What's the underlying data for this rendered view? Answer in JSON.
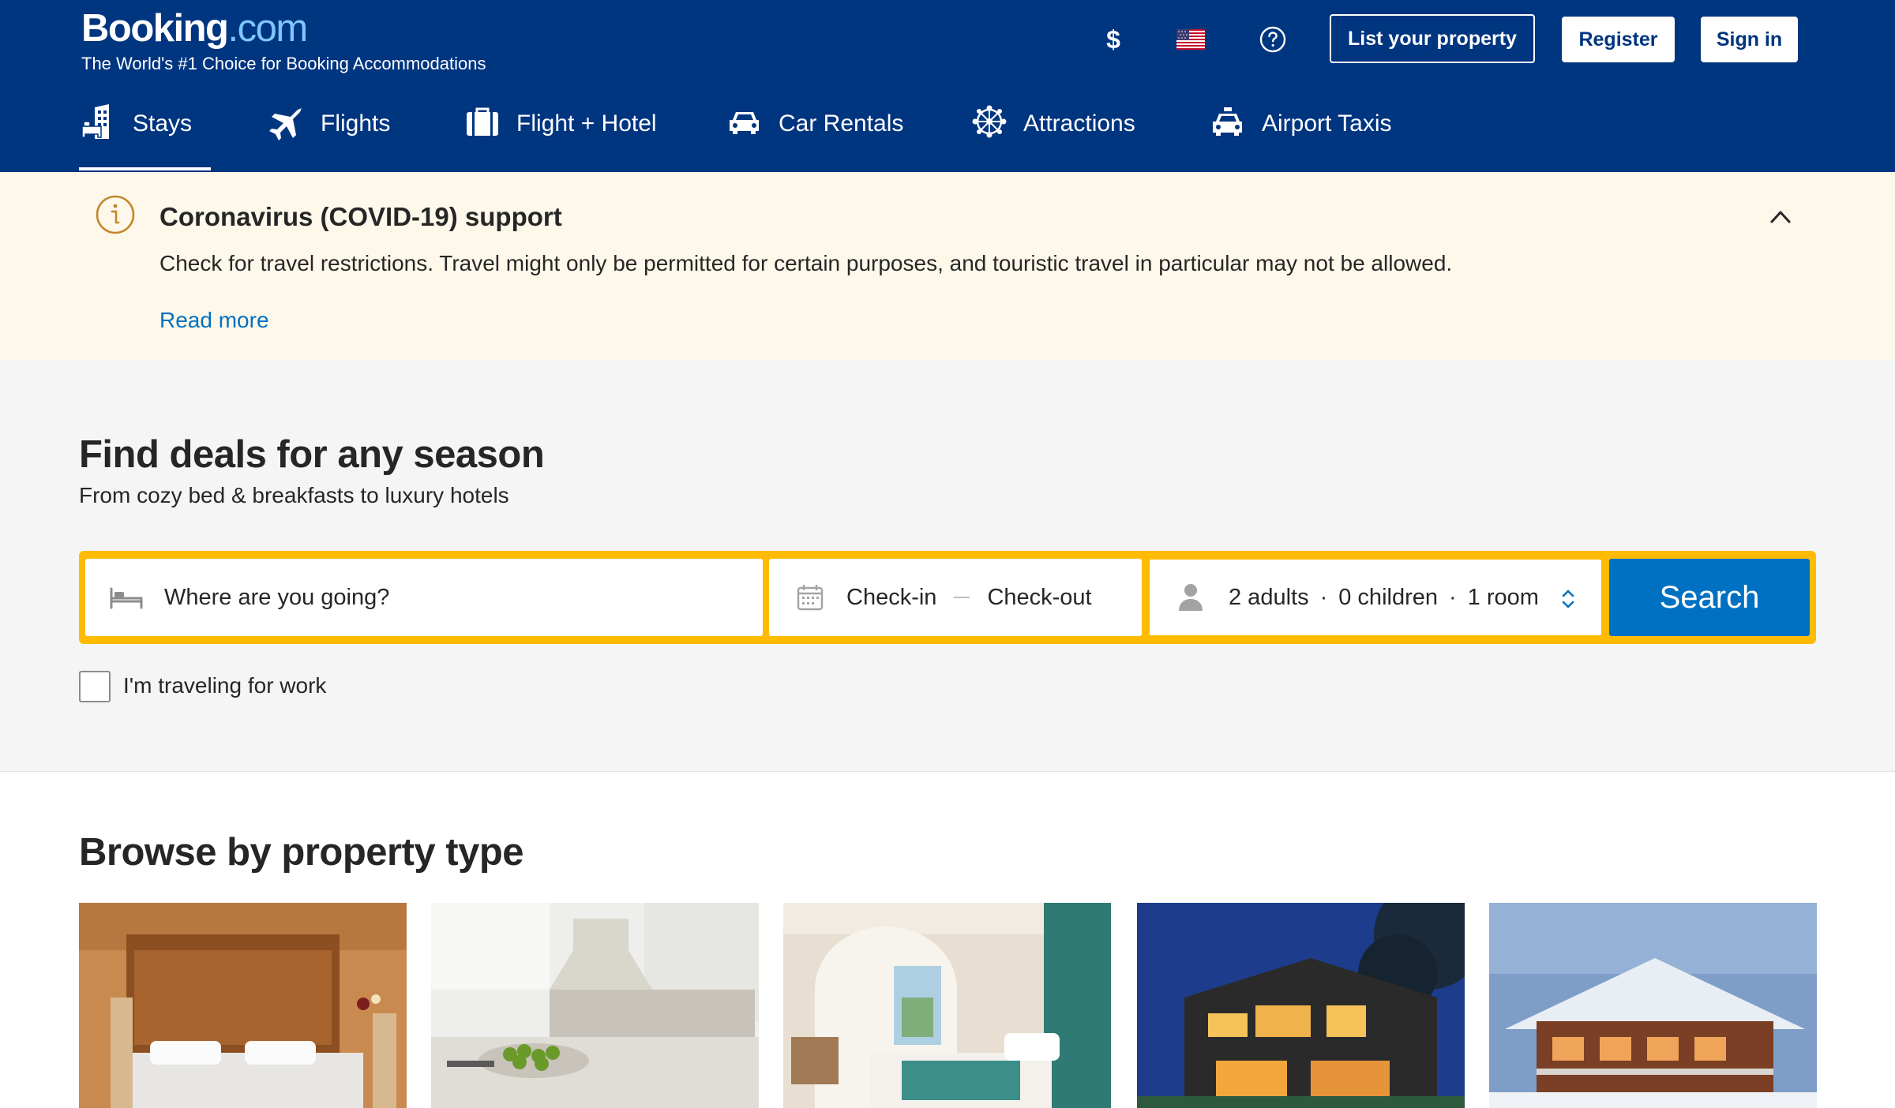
{
  "brand": {
    "name_main": "Booking",
    "name_suffix": ".com",
    "tagline": "The World's #1 Choice for Booking Accommodations"
  },
  "header": {
    "currency_symbol": "$",
    "flag_icon": "us-flag-icon",
    "help_icon": "help-circle-icon",
    "list_property_label": "List your property",
    "register_label": "Register",
    "signin_label": "Sign in"
  },
  "nav": {
    "tabs": [
      {
        "label": "Stays",
        "icon": "bed-building-icon",
        "active": true
      },
      {
        "label": "Flights",
        "icon": "airplane-icon",
        "active": false
      },
      {
        "label": "Flight + Hotel",
        "icon": "suitcase-icon",
        "active": false
      },
      {
        "label": "Car Rentals",
        "icon": "car-icon",
        "active": false
      },
      {
        "label": "Attractions",
        "icon": "ferris-wheel-icon",
        "active": false
      },
      {
        "label": "Airport Taxis",
        "icon": "taxi-icon",
        "active": false
      }
    ]
  },
  "covid": {
    "title": "Coronavirus (COVID-19) support",
    "text": "Check for travel restrictions. Travel might only be permitted for certain purposes, and touristic travel in particular may not be allowed.",
    "link": "Read more"
  },
  "hero": {
    "title": "Find deals for any season",
    "subtitle": "From cozy bed & breakfasts to luxury hotels"
  },
  "search": {
    "destination_placeholder": "Where are you going?",
    "checkin_label": "Check-in",
    "checkout_label": "Check-out",
    "adults": "2 adults",
    "children": "0 children",
    "rooms": "1 room",
    "button_label": "Search",
    "work_label": "I'm traveling for work",
    "work_checked": false
  },
  "browse": {
    "title": "Browse by property type"
  },
  "colors": {
    "header_bg": "#003580",
    "accent_yellow": "#febb02",
    "search_blue": "#0071c2",
    "banner_bg": "#fdf8ea",
    "covid_icon": "#c4862a"
  }
}
